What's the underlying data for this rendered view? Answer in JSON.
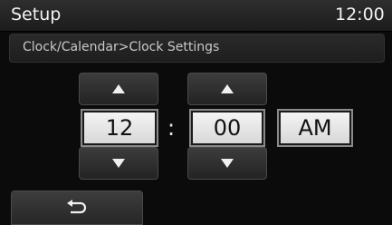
{
  "header": {
    "title": "Setup",
    "time": "12:00"
  },
  "breadcrumb": "Clock/Calendar>Clock Settings",
  "clock_settings": {
    "hour": "12",
    "separator": ":",
    "minute": "00",
    "period": "AM"
  },
  "icons": {
    "up": "up-arrow-icon",
    "down": "down-arrow-icon",
    "back": "back-return-icon"
  }
}
